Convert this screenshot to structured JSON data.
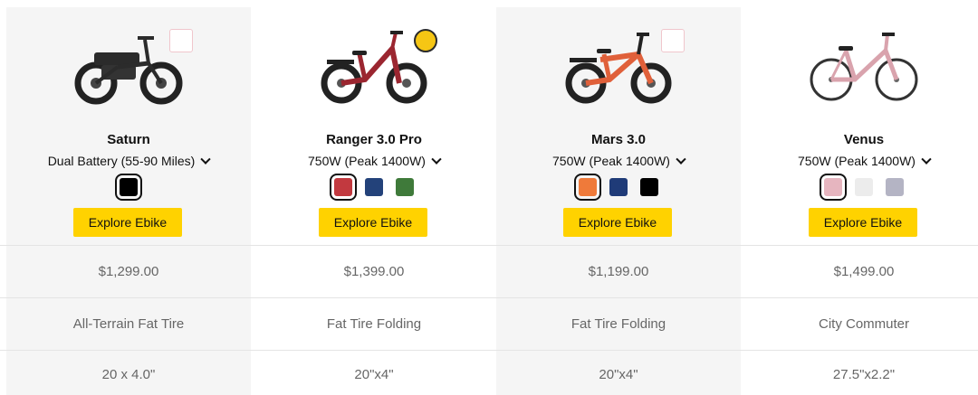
{
  "products": [
    {
      "name": "Saturn",
      "variant": "Dual Battery (55-90 Miles)",
      "button": "Explore Ebike",
      "price": "$1,299.00",
      "category": "All-Terrain Fat Tire",
      "tire": "20 x 4.0\"",
      "swatches": [
        "#000000"
      ],
      "selected_swatch": 0,
      "badge": "pink",
      "frame_color": "#2b2b2b"
    },
    {
      "name": "Ranger 3.0 Pro",
      "variant": "750W (Peak 1400W)",
      "button": "Explore Ebike",
      "price": "$1,399.00",
      "category": "Fat Tire Folding",
      "tire": "20\"x4\"",
      "swatches": [
        "#c2393f",
        "#23427a",
        "#3f7a3a"
      ],
      "selected_swatch": 0,
      "badge": "gold",
      "frame_color": "#9b2630"
    },
    {
      "name": "Mars 3.0",
      "variant": "750W (Peak 1400W)",
      "button": "Explore Ebike",
      "price": "$1,199.00",
      "category": "Fat Tire Folding",
      "tire": "20\"x4\"",
      "swatches": [
        "#ef7a3a",
        "#1f3b78",
        "#000000"
      ],
      "selected_swatch": 0,
      "badge": "pink",
      "frame_color": "#e0603a"
    },
    {
      "name": "Venus",
      "variant": "750W (Peak 1400W)",
      "button": "Explore Ebike",
      "price": "$1,499.00",
      "category": "City Commuter",
      "tire": "27.5\"x2.2\"",
      "swatches": [
        "#e6b5bf",
        "#ececec",
        "#b4b4c4"
      ],
      "selected_swatch": 0,
      "badge": "",
      "frame_color": "#d9a3ad"
    }
  ]
}
